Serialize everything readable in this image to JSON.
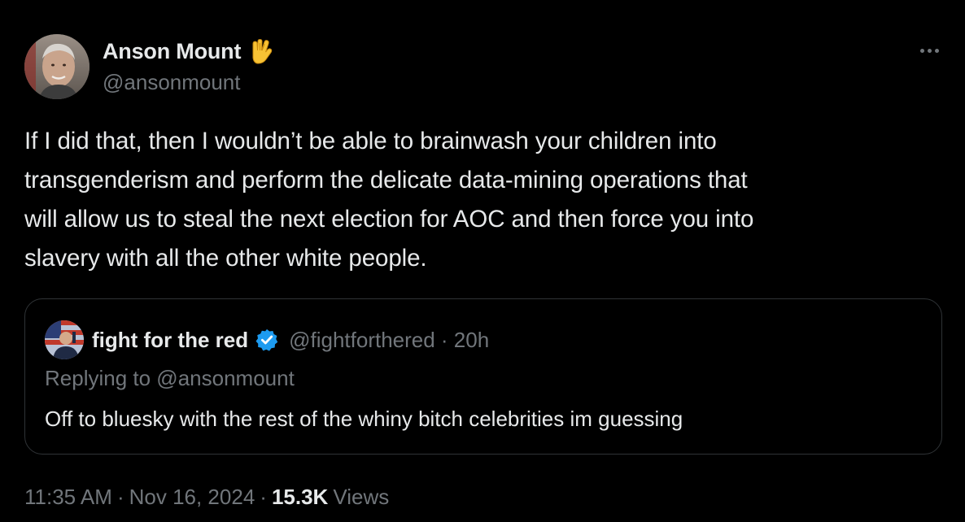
{
  "author": {
    "display_name": "Anson Mount",
    "handle": "@ansonmount",
    "badge_icon": "vulcan-salute-icon"
  },
  "tweet": {
    "text_lines": [
      "If I did that, then I wouldn’t be able to brainwash your children into",
      "transgenderism and perform the delicate data-mining operations that",
      "will allow us to steal the next election for AOC and then force you into",
      "slavery with all the other white people."
    ]
  },
  "quoted": {
    "display_name": "fight for the red",
    "verified_icon": "verified-badge-icon",
    "meta": "@fightforthered · 20h",
    "replying_to": "Replying to @ansonmount",
    "text": "Off to bluesky with the rest of the whiny bitch celebrities im guessing"
  },
  "footer": {
    "time": "11:35 AM",
    "date": "Nov 16, 2024",
    "views_count": "15.3K",
    "views_label": "Views"
  },
  "colors": {
    "background": "#000000",
    "primary_text": "#e7e9ea",
    "secondary_text": "#71767b",
    "border": "#2f3336",
    "verified": "#1d9bf0",
    "emoji_yellow": "#f7c234"
  }
}
